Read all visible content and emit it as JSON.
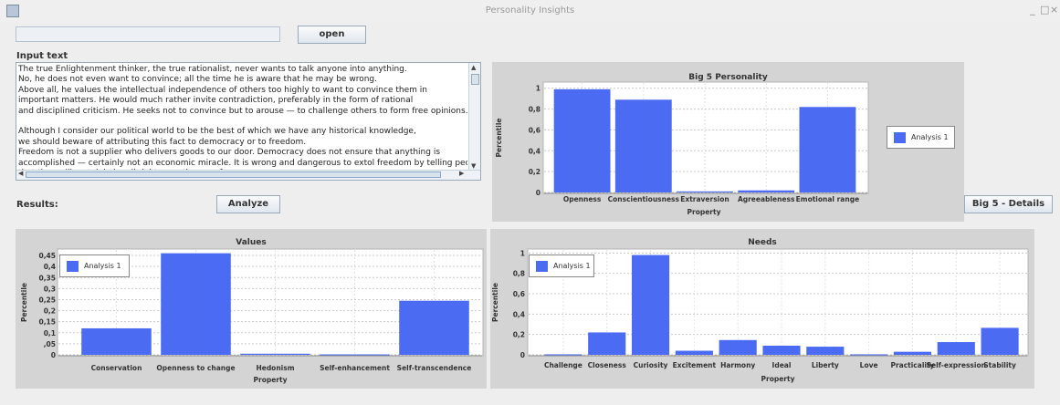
{
  "window": {
    "title": "Personality Insights",
    "minimize": "_",
    "maximize": "□",
    "close": "×"
  },
  "file": {
    "path_value": "",
    "open_label": "open"
  },
  "input": {
    "label": "Input text",
    "text": "The true Enlightenment thinker, the true rationalist, never wants to talk anyone into anything.\nNo, he does not even want to convince; all the time he is aware that he may be wrong.\nAbove all, he values the intellectual independence of others too highly to want to convince them in\nimportant matters. He would much rather invite contradiction, preferably in the form of rational\nand disciplined criticism. He seeks not to convince but to arouse — to challenge others to form free opinions.\n\nAlthough I consider our political world to be the best of which we have any historical knowledge,\nwe should beware of attributing this fact to democracy or to freedom.\nFreedom is not a supplier who delivers goods to our door. Democracy does not ensure that anything is\naccomplished — certainly not an economic miracle. It is wrong and dangerous to extol freedom by telling people\nthat they will certainly be all right once they are free."
  },
  "results": {
    "label": "Results:",
    "analyze_label": "Analyze",
    "details_label": "Big 5 - Details"
  },
  "colors": {
    "bar": "#4b6bf3",
    "panel": "#d4d4d4",
    "grid": "#c8c8c8"
  },
  "chart_data": [
    {
      "type": "bar",
      "title": "Big 5 Personality",
      "xlabel": "Property",
      "ylabel": "Percentile",
      "categories": [
        "Openness",
        "Conscientiousness",
        "Extraversion",
        "Agreeableness",
        "Emotional range"
      ],
      "series": [
        {
          "name": "Analysis 1",
          "values": [
            0.99,
            0.89,
            0.01,
            0.02,
            0.82
          ]
        }
      ],
      "yticks": [
        0,
        0.2,
        0.4,
        0.6,
        0.8,
        1
      ],
      "ytick_labels": [
        "0",
        "0,2",
        "0,4",
        "0,6",
        "0,8",
        "1"
      ],
      "ylim": [
        0,
        1.05
      ],
      "legend": "right",
      "grid": true
    },
    {
      "type": "bar",
      "title": "Values",
      "xlabel": "Property",
      "ylabel": "Percentile",
      "categories": [
        "Conservation",
        "Openness to change",
        "Hedonism",
        "Self-enhancement",
        "Self-transcendence"
      ],
      "series": [
        {
          "name": "Analysis 1",
          "values": [
            0.12,
            0.46,
            0.005,
            0.002,
            0.245
          ]
        }
      ],
      "yticks": [
        0,
        0.05,
        0.1,
        0.15,
        0.2,
        0.25,
        0.3,
        0.35,
        0.4,
        0.45
      ],
      "ytick_labels": [
        "0",
        ",05",
        "0,1",
        "0,15",
        "0,2",
        "0,25",
        "0,3",
        "0,35",
        "0,4",
        "0,45"
      ],
      "ylim": [
        0,
        0.475
      ],
      "legend": "top-left",
      "grid": true
    },
    {
      "type": "bar",
      "title": "Needs",
      "xlabel": "Property",
      "ylabel": "Percentile",
      "categories": [
        "Challenge",
        "Closeness",
        "Curiosity",
        "Excitement",
        "Harmony",
        "Ideal",
        "Liberty",
        "Love",
        "Practicality",
        "Self-expression",
        "Stability"
      ],
      "series": [
        {
          "name": "Analysis 1",
          "values": [
            0.005,
            0.22,
            0.98,
            0.04,
            0.145,
            0.09,
            0.08,
            0.005,
            0.03,
            0.125,
            0.265
          ]
        }
      ],
      "yticks": [
        0,
        0.2,
        0.4,
        0.6,
        0.8,
        1
      ],
      "ytick_labels": [
        "0",
        "0,2",
        "0,4",
        "0,6",
        "0,8",
        "1"
      ],
      "ylim": [
        0,
        1.03
      ],
      "legend": "top-left",
      "grid": true
    }
  ]
}
